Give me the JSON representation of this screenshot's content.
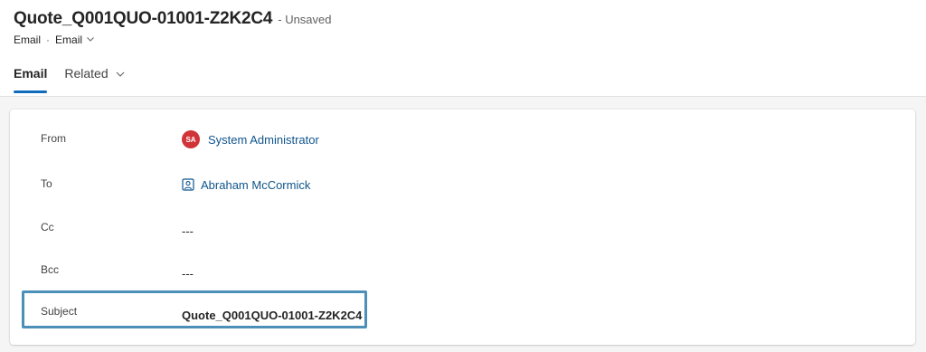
{
  "header": {
    "title": "Quote_Q001QUO-01001-Z2K2C4",
    "save_status": "- Unsaved",
    "breadcrumb": {
      "entity": "Email",
      "separator": "·",
      "form": "Email"
    }
  },
  "tabs": [
    {
      "label": "Email",
      "active": true
    },
    {
      "label": "Related",
      "active": false
    }
  ],
  "form": {
    "from": {
      "label": "From",
      "avatar_initials": "SA",
      "value": "System Administrator"
    },
    "to": {
      "label": "To",
      "value": "Abraham McCormick"
    },
    "cc": {
      "label": "Cc",
      "value": "---"
    },
    "bcc": {
      "label": "Bcc",
      "value": "---"
    },
    "subject": {
      "label": "Subject",
      "value": "Quote_Q001QUO-01001-Z2K2C4"
    }
  },
  "icons": {
    "form_selector": "chevron-down-icon",
    "related_tab": "chevron-down-icon",
    "to_field": "contact-card-icon"
  },
  "colors": {
    "accent": "#0f6cbd",
    "link": "#0f548c",
    "avatar": "#d13438",
    "highlight": "#4c8fb8"
  }
}
